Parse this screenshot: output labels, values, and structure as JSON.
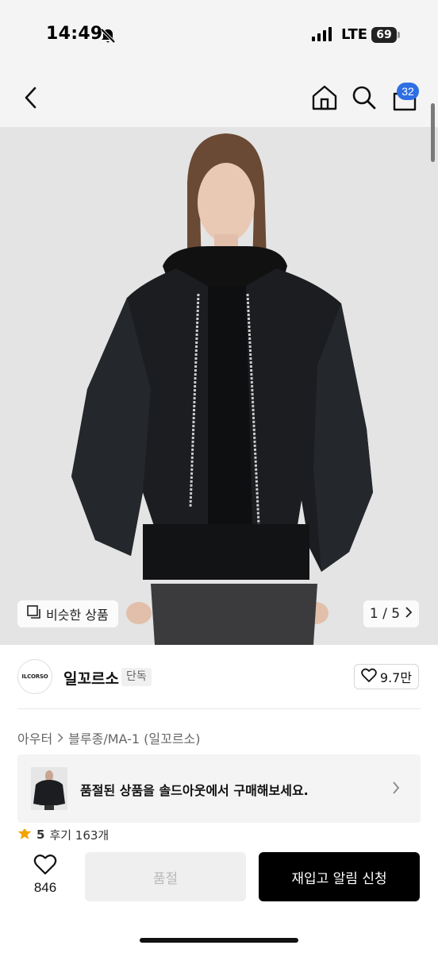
{
  "status_bar": {
    "time": "14:49",
    "network": "LTE",
    "battery": "69",
    "icons": [
      "bell-slash-icon",
      "signal-icon",
      "battery-icon"
    ]
  },
  "nav": {
    "icons": [
      "back-chevron-icon",
      "home-icon",
      "search-icon",
      "cart-icon"
    ],
    "cart_count": "32",
    "accent": "#2f6fe4"
  },
  "hero": {
    "similar_label": "비슷한 상품",
    "pager": "1 / 5",
    "icons": [
      "similar-icon",
      "chevron-right-icon"
    ]
  },
  "brand": {
    "logo_text": "ILCORSO",
    "name": "일꼬르소",
    "tag": "단독",
    "likes": "9.7만"
  },
  "breadcrumb": {
    "items": [
      "아우터",
      "블루종/MA-1 (일꼬르소)"
    ]
  },
  "soldout_banner": {
    "message": "품절된 상품을 솔드아웃에서 구매해보세요."
  },
  "rating_peek": {
    "score": "5",
    "reviews": "후기 163개"
  },
  "bottom_bar": {
    "wish_count": "846",
    "soldout_label": "품절",
    "restock_label": "재입고 알림 신청",
    "colors": {
      "primary": "#000000",
      "disabled_bg": "#efefef"
    }
  }
}
